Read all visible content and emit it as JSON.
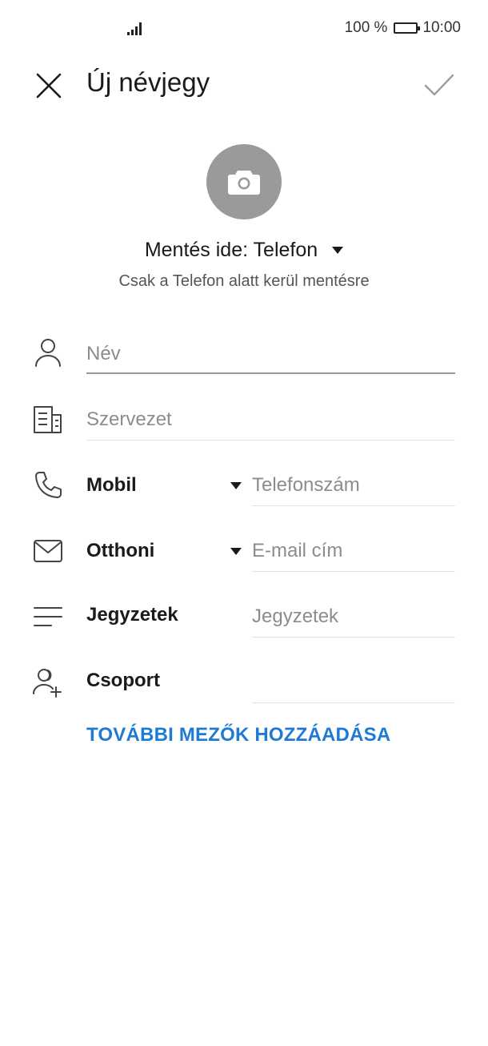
{
  "status_bar": {
    "battery_text": "100 %",
    "time": "10:00"
  },
  "header": {
    "title": "Új névjegy"
  },
  "save": {
    "label": "Mentés ide: Telefon",
    "note": "Csak a Telefon alatt kerül mentésre"
  },
  "fields": {
    "name_placeholder": "Név",
    "org_placeholder": "Szervezet",
    "phone_type": "Mobil",
    "phone_placeholder": "Telefonszám",
    "email_type": "Otthoni",
    "email_placeholder": "E-mail cím",
    "notes_label": "Jegyzetek",
    "notes_placeholder": "Jegyzetek",
    "group_label": "Csoport"
  },
  "actions": {
    "add_more_fields": "TOVÁBBI MEZŐK HOZZÁADÁSA"
  },
  "colors": {
    "accent": "#1f7ad6",
    "avatar_bg": "#9a9a9a"
  }
}
